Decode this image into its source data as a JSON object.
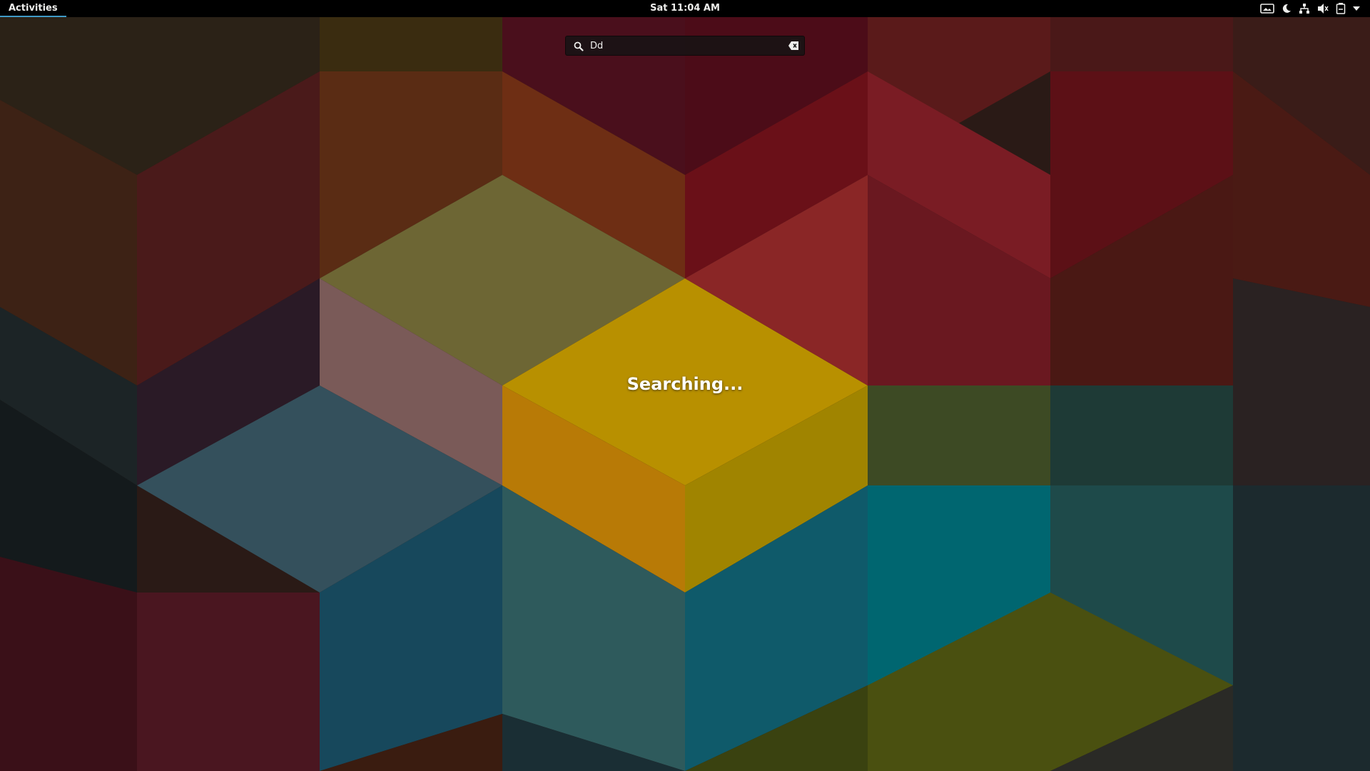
{
  "topbar": {
    "activities_label": "Activities",
    "clock_text": "Sat 11:04 AM",
    "accent_color": "#3f9bc7",
    "tray_icons": [
      "screen-icon",
      "night-light-icon",
      "network-icon",
      "volume-muted-icon",
      "battery-icon",
      "system-menu-arrow-icon"
    ]
  },
  "search": {
    "value": "Dd",
    "icon": "search-icon",
    "clear_icon": "clear-icon"
  },
  "status": {
    "text": "Searching..."
  },
  "colors": {
    "panel_bg": "#000000",
    "text": "#eeeeec"
  }
}
